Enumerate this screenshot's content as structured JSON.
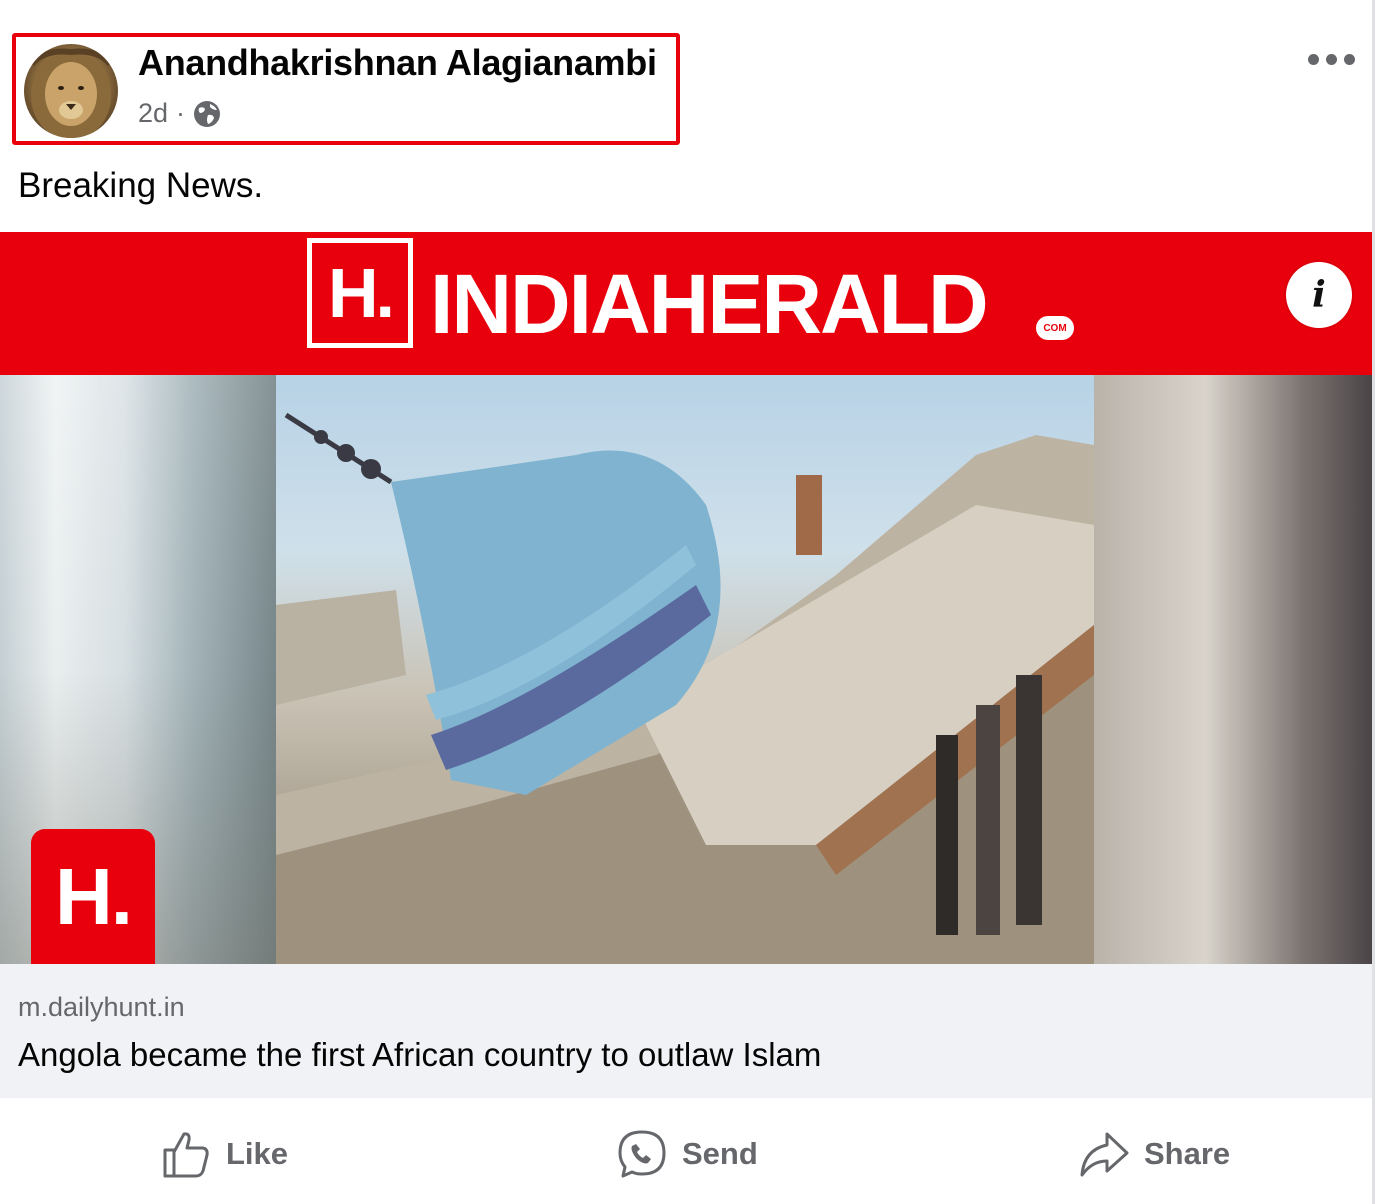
{
  "post": {
    "author_name": "Anandhakrishnan Alagianambi",
    "time": "2d",
    "separator": "·",
    "text": "Breaking News."
  },
  "media": {
    "brand_mark": "H.",
    "brand_word": "INDIAHERALD",
    "brand_suffix": "COM",
    "info_label": "i",
    "corner_mark": "H."
  },
  "link": {
    "domain": "m.dailyhunt.in",
    "title": "Angola became the first African country to outlaw Islam"
  },
  "actions": {
    "like": "Like",
    "send": "Send",
    "share": "Share"
  },
  "colors": {
    "highlight_border": "#e8000c",
    "brand_red": "#e8000c",
    "secondary_text": "#65676b",
    "preview_bg": "#f0f2f5"
  },
  "icons": [
    "globe-icon",
    "more-options-icon",
    "info-icon",
    "like-icon",
    "messenger-icon",
    "share-icon"
  ]
}
